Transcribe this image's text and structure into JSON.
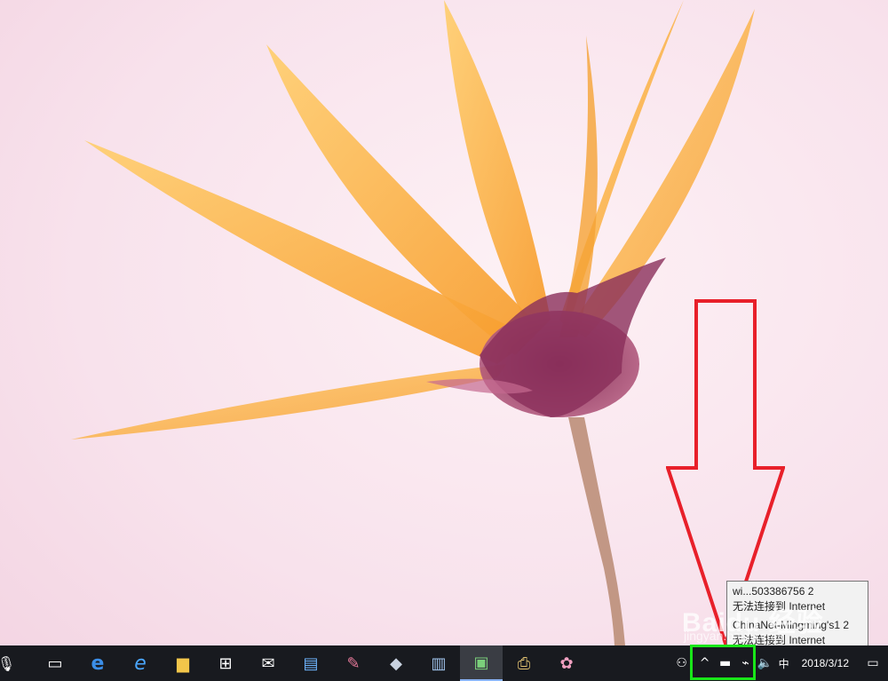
{
  "taskbar": {
    "clock_date": "2018/3/12",
    "input_method": "中",
    "tray_overflow_glyph": "^",
    "pinned_apps": [
      {
        "name": "task-view",
        "glyph": "▭"
      },
      {
        "name": "edge",
        "glyph": "e"
      },
      {
        "name": "internet-explorer",
        "glyph": "e"
      },
      {
        "name": "file-explorer",
        "glyph": "▆"
      },
      {
        "name": "store",
        "glyph": "⊞"
      },
      {
        "name": "mail",
        "glyph": "✉"
      },
      {
        "name": "app-monitor",
        "glyph": "▤"
      },
      {
        "name": "app-paint",
        "glyph": "✎"
      },
      {
        "name": "app-media",
        "glyph": "◆"
      },
      {
        "name": "app-notepad",
        "glyph": "▥"
      },
      {
        "name": "app-active-window",
        "glyph": "▣"
      },
      {
        "name": "app-printer",
        "glyph": "⎙"
      },
      {
        "name": "app-palette",
        "glyph": "✿"
      }
    ]
  },
  "network_tooltip": {
    "lines": [
      "wi...503386756  2",
      "无法连接到 Internet",
      "",
      "ChinaNet-Mingming's1  2",
      "无法连接到 Internet"
    ]
  },
  "watermark": {
    "brand": "Baidu 经验",
    "site": "jingyan.baidu.com"
  },
  "colors": {
    "highlight_box": "#19e619",
    "arrow": "#e8202a",
    "taskbar": "#181a1f"
  }
}
